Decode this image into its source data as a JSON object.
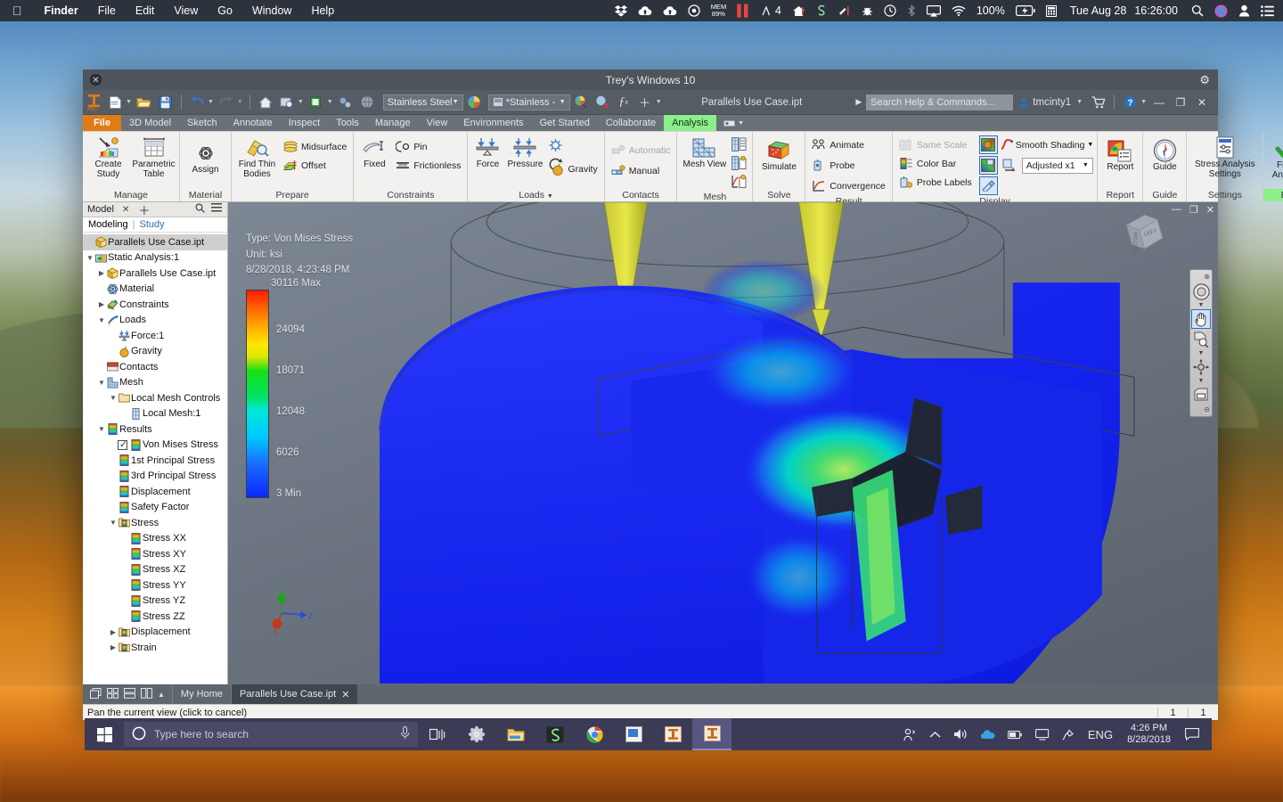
{
  "macbar": {
    "apple_icon": "apple-icon",
    "menus": [
      {
        "label": "Finder",
        "bold": true
      },
      {
        "label": "File"
      },
      {
        "label": "Edit"
      },
      {
        "label": "View"
      },
      {
        "label": "Go"
      },
      {
        "label": "Window"
      },
      {
        "label": "Help"
      }
    ],
    "status_icons": [
      {
        "name": "dropbox-icon",
        "glyph": "❖"
      },
      {
        "name": "cloud-upload-icon",
        "glyph": "⛅"
      },
      {
        "name": "cloud-upload-2-icon",
        "glyph": "⛅"
      },
      {
        "name": "target-icon",
        "glyph": "◎"
      }
    ],
    "memory_label": "MEM",
    "memory_value": "89%",
    "app_count": "4",
    "battery": "100%",
    "date": "Tue Aug 28",
    "time": "16:26:00"
  },
  "window": {
    "title": "Trey's Windows 10",
    "close_icon": "close-icon",
    "settings_icon": "gear-icon"
  },
  "qat": {
    "logo": "inventor-pro-logo",
    "document_title": "Parallels Use Case.ipt",
    "material_value": "Stainless Steel",
    "appearance_value": "*Stainless -",
    "search_placeholder": "Search Help & Commands...",
    "user_name": "tmcinty1",
    "cart_icon": "cart-icon",
    "help_icon": "help-icon",
    "minimize_icon": "minimize-icon",
    "restore_icon": "restore-icon",
    "close_icon": "close-icon"
  },
  "ribbon_tabs": [
    {
      "label": "File",
      "state": "file"
    },
    {
      "label": "3D Model",
      "state": "normal"
    },
    {
      "label": "Sketch",
      "state": "normal"
    },
    {
      "label": "Annotate",
      "state": "normal"
    },
    {
      "label": "Inspect",
      "state": "normal"
    },
    {
      "label": "Tools",
      "state": "normal"
    },
    {
      "label": "Manage",
      "state": "normal"
    },
    {
      "label": "View",
      "state": "normal"
    },
    {
      "label": "Environments",
      "state": "normal"
    },
    {
      "label": "Get Started",
      "state": "normal"
    },
    {
      "label": "Collaborate",
      "state": "normal"
    },
    {
      "label": "Analysis",
      "state": "active"
    }
  ],
  "ribbon": {
    "panels": [
      {
        "label": "Manage",
        "items": [
          {
            "kind": "big",
            "name": "create-study-button",
            "label": "Create\nStudy",
            "icon": "create-study-icon"
          },
          {
            "kind": "big",
            "name": "parametric-table-button",
            "label": "Parametric\nTable",
            "icon": "parametric-table-icon"
          }
        ]
      },
      {
        "label": "Material",
        "items": [
          {
            "kind": "big",
            "name": "assign-button",
            "label": "Assign",
            "icon": "assign-material-icon"
          }
        ]
      },
      {
        "label": "Prepare",
        "items": [
          {
            "kind": "big",
            "name": "find-thin-bodies-button",
            "label": "Find Thin\nBodies",
            "icon": "find-thin-bodies-icon"
          },
          {
            "kind": "small",
            "name": "midsurface-button",
            "label": "Midsurface",
            "icon": "midsurface-icon"
          },
          {
            "kind": "small",
            "name": "offset-button",
            "label": "Offset",
            "icon": "offset-icon"
          }
        ]
      },
      {
        "label": "Constraints",
        "items": [
          {
            "kind": "big",
            "name": "fixed-constraint-button",
            "label": "Fixed",
            "icon": "fixed-constraint-icon"
          },
          {
            "kind": "small",
            "name": "pin-constraint-button",
            "label": "Pin",
            "icon": "pin-constraint-icon"
          },
          {
            "kind": "small",
            "name": "frictionless-constraint-button",
            "label": "Frictionless",
            "icon": "frictionless-icon"
          }
        ]
      },
      {
        "label": "Loads",
        "dropdown": true,
        "items": [
          {
            "kind": "big",
            "name": "force-load-button",
            "label": "Force",
            "icon": "force-icon"
          },
          {
            "kind": "big",
            "name": "pressure-load-button",
            "label": "Pressure",
            "icon": "pressure-icon"
          },
          {
            "kind": "small",
            "name": "body-load-button",
            "label": "",
            "icon": "body-load-icon"
          },
          {
            "kind": "small",
            "name": "moment-load-button",
            "label": "",
            "icon": "moment-icon"
          },
          {
            "kind": "small",
            "name": "gravity-load-button",
            "label": "Gravity",
            "icon": "gravity-icon"
          }
        ]
      },
      {
        "label": "Contacts",
        "items": [
          {
            "kind": "small",
            "name": "automatic-contacts-button",
            "label": "Automatic",
            "icon": "automatic-contacts-icon",
            "disabled": true
          },
          {
            "kind": "small",
            "name": "manual-contacts-button",
            "label": "Manual",
            "icon": "manual-contacts-icon"
          }
        ]
      },
      {
        "label": "Mesh",
        "items": [
          {
            "kind": "big",
            "name": "mesh-view-button",
            "label": "Mesh View",
            "icon": "mesh-view-icon"
          },
          {
            "kind": "small",
            "name": "mesh-settings-button",
            "label": "",
            "icon": "mesh-settings-icon"
          },
          {
            "kind": "small",
            "name": "local-mesh-control-button",
            "label": "",
            "icon": "local-mesh-icon"
          },
          {
            "kind": "small",
            "name": "convergence-settings-button",
            "label": "",
            "icon": "convergence-settings-icon"
          }
        ]
      },
      {
        "label": "Solve",
        "items": [
          {
            "kind": "big",
            "name": "simulate-button",
            "label": "Simulate",
            "icon": "simulate-icon"
          }
        ]
      },
      {
        "label": "Result",
        "items": [
          {
            "kind": "small",
            "name": "animate-button",
            "label": "Animate",
            "icon": "animate-icon"
          },
          {
            "kind": "small",
            "name": "probe-button",
            "label": "Probe",
            "icon": "probe-icon"
          },
          {
            "kind": "small",
            "name": "convergence-button",
            "label": "Convergence",
            "icon": "convergence-icon"
          }
        ]
      },
      {
        "label": "Display",
        "items": [
          {
            "kind": "small",
            "name": "same-scale-button",
            "label": "Same Scale",
            "icon": "same-scale-icon",
            "disabled": true
          },
          {
            "kind": "small",
            "name": "color-bar-button",
            "label": "Color Bar",
            "icon": "color-bar-icon"
          },
          {
            "kind": "small",
            "name": "probe-labels-button",
            "label": "Probe Labels",
            "icon": "probe-labels-icon"
          },
          {
            "kind": "combo",
            "name": "shading-mode-select",
            "label": "Smooth Shading"
          },
          {
            "kind": "combo",
            "name": "displacement-scale-select",
            "label": "Adjusted x1"
          }
        ]
      },
      {
        "label": "Report",
        "items": [
          {
            "kind": "big",
            "name": "report-button",
            "label": "Report",
            "icon": "report-icon"
          }
        ]
      },
      {
        "label": "Guide",
        "items": [
          {
            "kind": "big",
            "name": "guide-button",
            "label": "Guide",
            "icon": "guide-compass-icon"
          }
        ]
      },
      {
        "label": "Settings",
        "items": [
          {
            "kind": "big",
            "name": "stress-analysis-settings-button",
            "label": "Stress Analysis\nSettings",
            "icon": "settings-icon"
          }
        ]
      },
      {
        "label": "Exit",
        "highlight": true,
        "items": [
          {
            "kind": "big",
            "name": "finish-analysis-button",
            "label": "Finish\nAnalysis",
            "icon": "green-check-icon"
          }
        ]
      }
    ]
  },
  "browser": {
    "tab_label": "Model",
    "close_icon": "close-icon",
    "add_icon": "plus-icon",
    "search_icon": "search-icon",
    "menu_icon": "hamburger-icon",
    "sub_modeling": "Modeling",
    "sub_study": "Study",
    "tree": [
      {
        "label": "Parallels Use Case.ipt",
        "indent": 0,
        "twisty": "",
        "icon": "part-icon",
        "root": true
      },
      {
        "label": "Static Analysis:1",
        "indent": 0,
        "twisty": "v",
        "icon": "analysis-icon"
      },
      {
        "label": "Parallels Use Case.ipt",
        "indent": 1,
        "twisty": ">",
        "icon": "part-icon"
      },
      {
        "label": "Material",
        "indent": 1,
        "twisty": "",
        "icon": "material-icon"
      },
      {
        "label": "Constraints",
        "indent": 1,
        "twisty": ">",
        "icon": "constraints-icon"
      },
      {
        "label": "Loads",
        "indent": 1,
        "twisty": "v",
        "icon": "loads-icon"
      },
      {
        "label": "Force:1",
        "indent": 2,
        "twisty": "",
        "icon": "force-icon"
      },
      {
        "label": "Gravity",
        "indent": 2,
        "twisty": "",
        "icon": "gravity-icon"
      },
      {
        "label": "Contacts",
        "indent": 1,
        "twisty": "",
        "icon": "contacts-icon"
      },
      {
        "label": "Mesh",
        "indent": 1,
        "twisty": "v",
        "icon": "mesh-icon"
      },
      {
        "label": "Local Mesh Controls",
        "indent": 2,
        "twisty": "v",
        "icon": "folder-icon"
      },
      {
        "label": "Local Mesh:1",
        "indent": 3,
        "twisty": "",
        "icon": "local-mesh-icon"
      },
      {
        "label": "Results",
        "indent": 1,
        "twisty": "v",
        "icon": "results-icon"
      },
      {
        "label": "Von Mises Stress",
        "indent": 2,
        "twisty": "",
        "icon": "result-icon",
        "checked": true
      },
      {
        "label": "1st Principal Stress",
        "indent": 2,
        "twisty": "",
        "icon": "result-icon"
      },
      {
        "label": "3rd Principal Stress",
        "indent": 2,
        "twisty": "",
        "icon": "result-icon"
      },
      {
        "label": "Displacement",
        "indent": 2,
        "twisty": "",
        "icon": "result-icon"
      },
      {
        "label": "Safety Factor",
        "indent": 2,
        "twisty": "",
        "icon": "result-icon"
      },
      {
        "label": "Stress",
        "indent": 2,
        "twisty": "v",
        "icon": "folder-result-icon"
      },
      {
        "label": "Stress XX",
        "indent": 3,
        "twisty": "",
        "icon": "result-icon"
      },
      {
        "label": "Stress XY",
        "indent": 3,
        "twisty": "",
        "icon": "result-icon"
      },
      {
        "label": "Stress XZ",
        "indent": 3,
        "twisty": "",
        "icon": "result-icon"
      },
      {
        "label": "Stress YY",
        "indent": 3,
        "twisty": "",
        "icon": "result-icon"
      },
      {
        "label": "Stress YZ",
        "indent": 3,
        "twisty": "",
        "icon": "result-icon"
      },
      {
        "label": "Stress ZZ",
        "indent": 3,
        "twisty": "",
        "icon": "result-icon"
      },
      {
        "label": "Displacement",
        "indent": 2,
        "twisty": ">",
        "icon": "folder-result-icon"
      },
      {
        "label": "Strain",
        "indent": 2,
        "twisty": ">",
        "icon": "folder-result-icon"
      }
    ]
  },
  "viewport": {
    "result_type": "Type: Von Mises Stress",
    "result_unit": "Unit: ksi",
    "result_timestamp": "8/28/2018, 4:23:48 PM",
    "color_bar": {
      "max_label": "30116 Max",
      "min_label": "3 Min",
      "ticks": [
        "24094",
        "18071",
        "12048",
        "6026"
      ]
    },
    "viewcube_faces": [
      "LEFT",
      "BOTTOM"
    ],
    "axis_labels": [
      "X",
      "Y",
      "Z"
    ],
    "nav_tools": [
      {
        "name": "steering-wheel-icon",
        "glyph": "◎",
        "selected": false
      },
      {
        "name": "pan-hand-icon",
        "glyph": "✋",
        "selected": true
      },
      {
        "name": "zoom-window-icon",
        "glyph": "◱",
        "selected": false
      },
      {
        "name": "orbit-icon",
        "glyph": "✤",
        "selected": false
      },
      {
        "name": "look-at-icon",
        "glyph": "▣",
        "selected": false
      }
    ],
    "min_icon": "minimize-icon",
    "restore_icon": "restore-icon",
    "close_icon": "close-icon"
  },
  "docbar": {
    "view_icons": [
      {
        "name": "cascade-windows-icon",
        "glyph": "❐"
      },
      {
        "name": "tile-grid-icon",
        "glyph": "⊞"
      },
      {
        "name": "tile-horizontal-icon",
        "glyph": "☰"
      },
      {
        "name": "tile-vertical-icon",
        "glyph": "◫"
      },
      {
        "name": "collapse-arrow-icon",
        "glyph": "▲"
      }
    ],
    "tabs": [
      {
        "label": "My Home",
        "active": false,
        "closable": false
      },
      {
        "label": "Parallels Use Case.ipt",
        "active": true,
        "closable": true
      }
    ]
  },
  "status": {
    "message": "Pan the current view (click to cancel)",
    "cells": [
      "1",
      "1"
    ]
  },
  "taskbar": {
    "start_icon": "windows-start-icon",
    "search_placeholder": "Type here to search",
    "cortana_icon": "cortana-circle-icon",
    "mic_icon": "microphone-icon",
    "pinned": [
      {
        "name": "task-view-icon",
        "glyph": "⧉",
        "active": false
      },
      {
        "name": "settings-gear-icon",
        "glyph": "⚙",
        "active": false
      },
      {
        "name": "file-explorer-icon",
        "glyph": "Ὄ1",
        "active": false
      },
      {
        "name": "snagit-icon",
        "glyph": "S",
        "active": false
      },
      {
        "name": "chrome-icon",
        "glyph": "◉",
        "active": false
      },
      {
        "name": "paint-icon",
        "glyph": "▣",
        "active": false
      },
      {
        "name": "inventor-icon",
        "glyph": "I",
        "active": false
      },
      {
        "name": "inventor-active-icon",
        "glyph": "I",
        "active": true
      }
    ],
    "tray": [
      {
        "name": "people-icon",
        "glyph": "⛹"
      },
      {
        "name": "show-hidden-icons-icon",
        "glyph": "⌃"
      },
      {
        "name": "volume-icon",
        "glyph": "🔊"
      },
      {
        "name": "onedrive-icon",
        "glyph": "☁"
      },
      {
        "name": "battery-icon",
        "glyph": "▭"
      },
      {
        "name": "network-icon",
        "glyph": "🖥"
      },
      {
        "name": "pen-icon",
        "glyph": "✎"
      }
    ],
    "language": "ENG",
    "time": "4:26 PM",
    "date": "8/28/2018",
    "action_center_icon": "action-center-icon"
  },
  "colors": {
    "accent_orange": "#e07b18",
    "active_tab_green": "#8bf08b",
    "taskbar": "#3b3b55",
    "macbar": "#2d333d",
    "stress_max": "#ff1d00",
    "stress_min": "#0a27ff"
  }
}
